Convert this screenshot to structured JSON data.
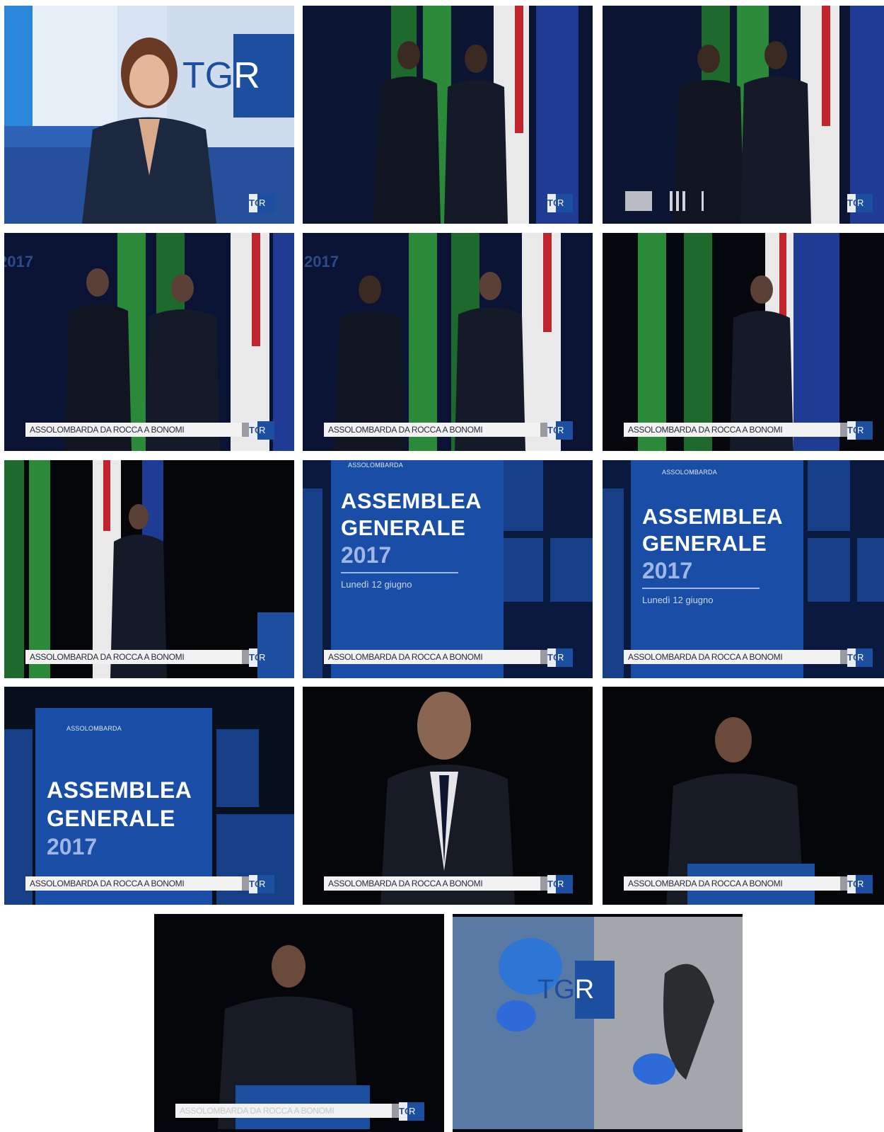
{
  "broadcast": {
    "logo_text": "TGR",
    "logo_small_left": "TG",
    "logo_small_right": "R",
    "caption": "ASSOLOMBARDA DA ROCCA A BONOMI"
  },
  "event_board": {
    "org": "ASSOLOMBARDA",
    "line1": "ASSEMBLEA",
    "line2": "GENERALE",
    "year": "2017",
    "date": "Lunedì 12 giugno"
  },
  "background_year": "2017",
  "colors": {
    "tgr_blue": "#1d4fa0",
    "board_blue": "#1a4ea6",
    "stage_dark": "#05070f",
    "caption_bg": "#f2f2f2"
  }
}
